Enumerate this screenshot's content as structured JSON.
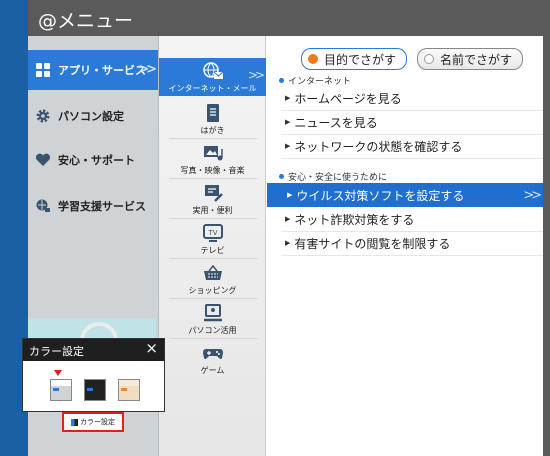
{
  "window": {
    "title": "@メニュー"
  },
  "categories": [
    {
      "label": "アプリ・サービス",
      "icon": "apps-grid-icon",
      "active": true
    },
    {
      "label": "パソコン設定",
      "icon": "gear-icon",
      "active": false
    },
    {
      "label": "安心・サポート",
      "icon": "heart-icon",
      "active": false
    },
    {
      "label": "学習支援サービス",
      "icon": "learning-globe-icon",
      "active": false
    }
  ],
  "subcategories": [
    {
      "label": "インターネット・メール",
      "icon": "globe-mail-icon",
      "active": true
    },
    {
      "label": "はがき",
      "icon": "postcard-icon",
      "active": false
    },
    {
      "label": "写真・映像・音楽",
      "icon": "photo-music-icon",
      "active": false
    },
    {
      "label": "実用・便利",
      "icon": "utility-icon",
      "active": false
    },
    {
      "label": "テレビ",
      "icon": "tv-icon",
      "active": false
    },
    {
      "label": "ショッピング",
      "icon": "shopping-basket-icon",
      "active": false
    },
    {
      "label": "パソコン活用",
      "icon": "pc-icon",
      "active": false
    },
    {
      "label": "ゲーム",
      "icon": "gamepad-icon",
      "active": false
    }
  ],
  "search_mode": {
    "purpose": "目的でさがす",
    "name": "名前でさがす",
    "selected": "purpose"
  },
  "sections": [
    {
      "title": "インターネット",
      "items": [
        {
          "label": "ホームページを見る",
          "active": false
        },
        {
          "label": "ニュースを見る",
          "active": false
        },
        {
          "label": "ネットワークの状態を確認する",
          "active": false
        }
      ]
    },
    {
      "title": "安心・安全に使うために",
      "items": [
        {
          "label": "ウイルス対策ソフトを設定する",
          "active": true
        },
        {
          "label": "ネット詐欺対策をする",
          "active": false
        },
        {
          "label": "有害サイトの閲覧を制限する",
          "active": false
        }
      ]
    }
  ],
  "color_popup": {
    "title": "カラー設定",
    "close": "×",
    "swatches": [
      {
        "name": "blue-theme",
        "selected": true
      },
      {
        "name": "dark-theme",
        "selected": false
      },
      {
        "name": "warm-theme",
        "selected": false
      }
    ]
  },
  "color_button": {
    "label": "カラー設定"
  },
  "colors": {
    "accent": "#2b7ad8",
    "highlight_text": "#ffffff",
    "selection_marker": "#e02020"
  }
}
